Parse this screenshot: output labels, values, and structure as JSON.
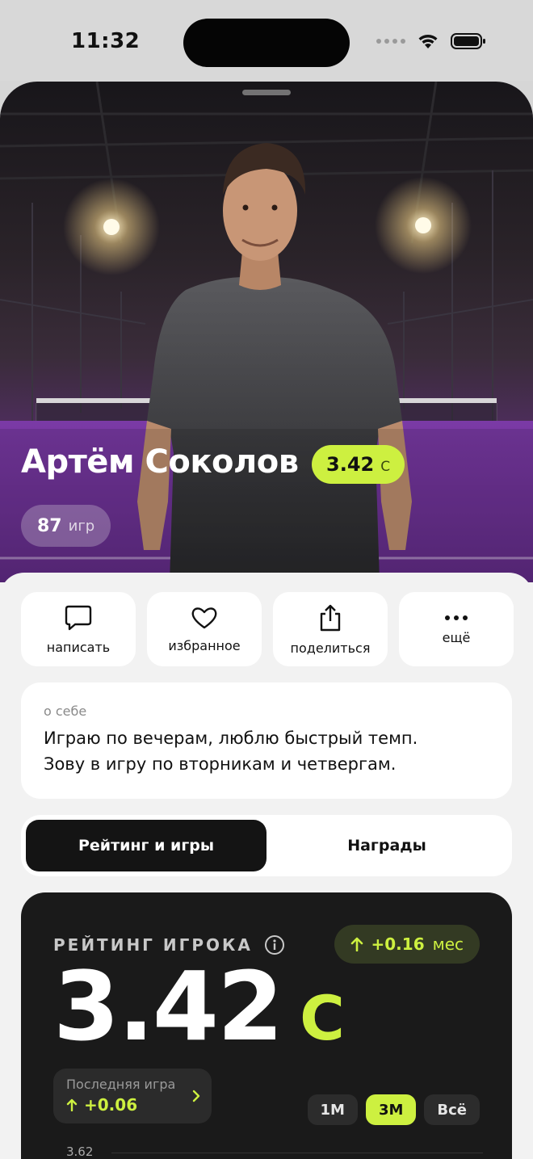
{
  "status_bar": {
    "time": "11:32"
  },
  "profile": {
    "name": "Артём Соколов",
    "rating_value": "3.42",
    "rating_level": "C",
    "games_count": "87",
    "games_label": "игр"
  },
  "actions": [
    {
      "label": "написать",
      "icon": "chat-bubble-icon"
    },
    {
      "label": "избранное",
      "icon": "heart-icon"
    },
    {
      "label": "поделиться",
      "icon": "share-icon"
    },
    {
      "label": "ещё",
      "icon": "more-dots-icon"
    }
  ],
  "about": {
    "caption": "о себе",
    "text_line1": "Играю по вечерам, люблю быстрый темп.",
    "text_line2": "Зову в игру по вторникам и четвергам."
  },
  "tabs": [
    {
      "label": "Рейтинг и игры",
      "active": true
    },
    {
      "label": "Награды",
      "active": false
    }
  ],
  "rating_card": {
    "title": "РЕЙТИНГ ИГРОКА",
    "monthly_delta": "+0.16",
    "monthly_delta_unit": "мес",
    "value": "3.42",
    "level": "C",
    "last_game_caption": "Последняя игра",
    "last_game_delta": "+0.06",
    "periods": [
      "1M",
      "3M",
      "Всё"
    ],
    "active_period": "3M",
    "y_tick_top": "3.62"
  },
  "colors": {
    "accent": "#cdf040",
    "card_dark": "#1a1a1a",
    "page_bg": "#f2f2f2"
  }
}
